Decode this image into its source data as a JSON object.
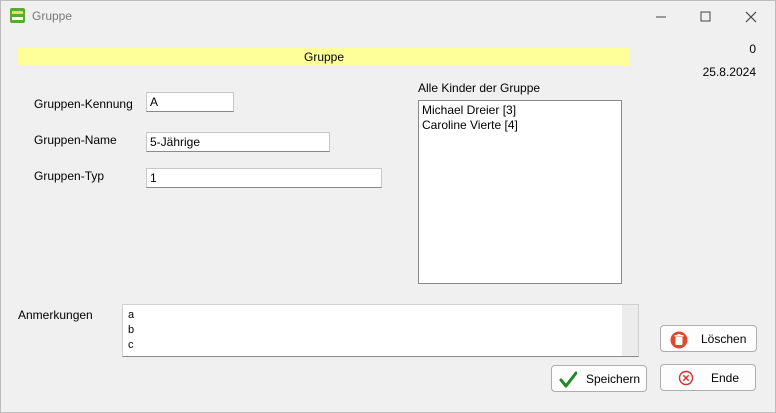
{
  "window": {
    "title": "Gruppe"
  },
  "header": {
    "banner": "Gruppe",
    "counter": "0",
    "date": "25.8.2024"
  },
  "form": {
    "kennung_label": "Gruppen-Kennung",
    "kennung_value": "A",
    "name_label": "Gruppen-Name",
    "name_value": "5-Jährige",
    "typ_label": "Gruppen-Typ",
    "typ_value": "1"
  },
  "children": {
    "label": "Alle Kinder der Gruppe",
    "items": [
      "Michael Dreier [3]",
      "Caroline Vierte [4]"
    ]
  },
  "notes": {
    "label": "Anmerkungen",
    "lines": [
      "a",
      "b",
      "c"
    ]
  },
  "buttons": {
    "delete": "Löschen",
    "save": "Speichern",
    "end": "Ende"
  },
  "colors": {
    "banner": "#ffff99",
    "delete_icon": "#e0472b",
    "save_icon": "#1f8a24",
    "end_icon": "#d32f2f"
  },
  "icons": {
    "app": "app-logo-icon",
    "delete": "trash-icon",
    "save": "checkmark-icon",
    "end": "close-circle-icon"
  }
}
